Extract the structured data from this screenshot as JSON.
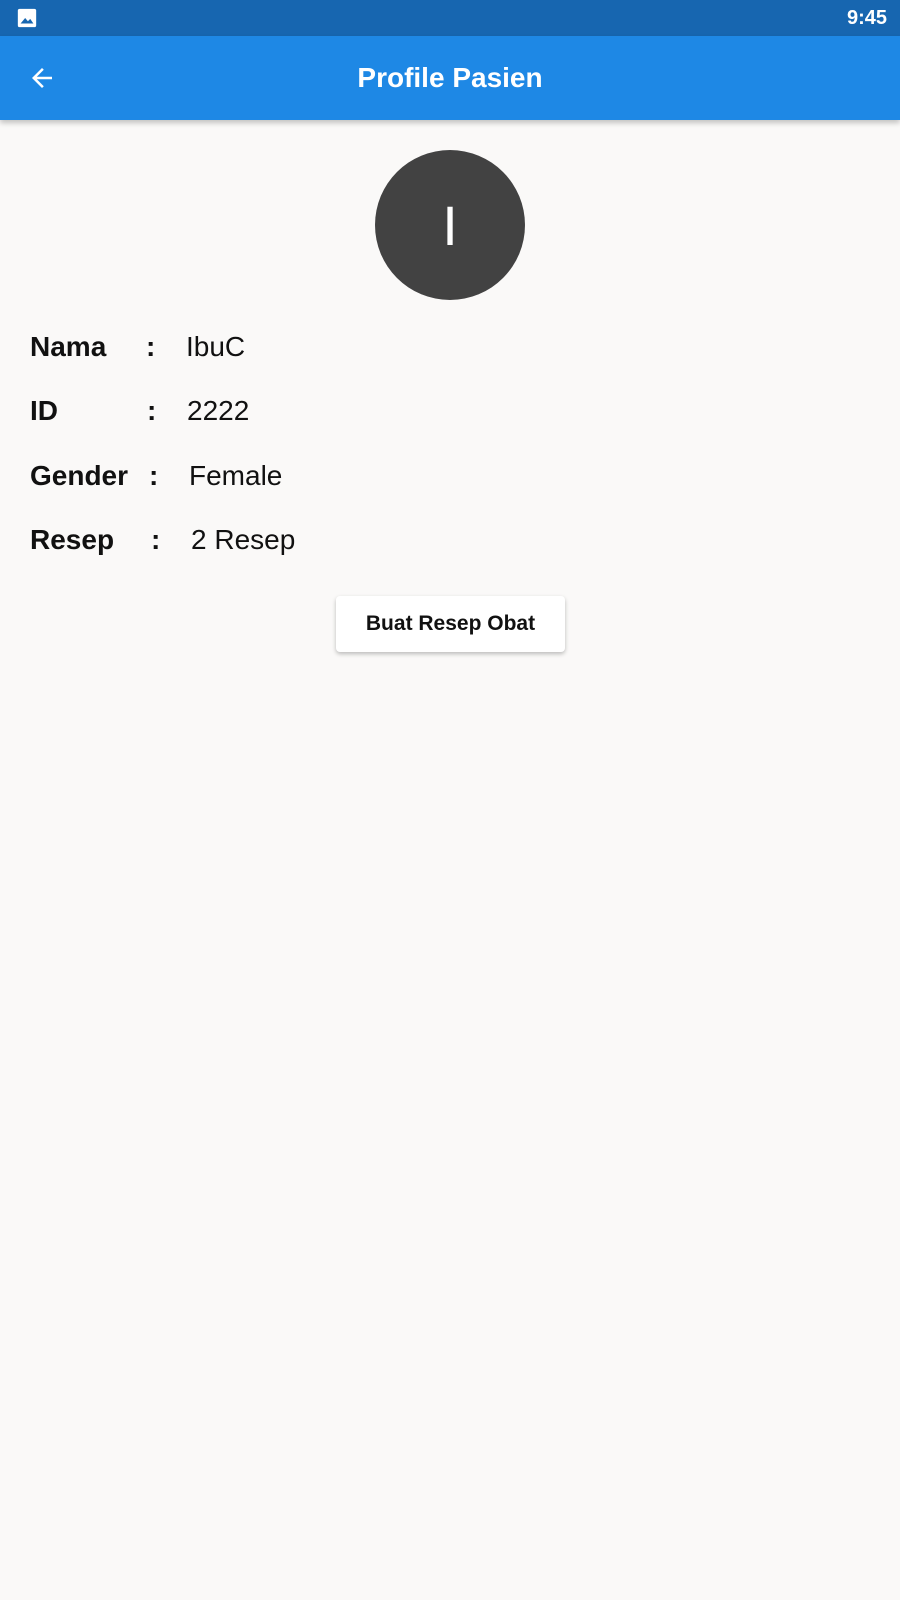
{
  "status_bar": {
    "time": "9:45",
    "notification_icon": "image-icon"
  },
  "app_bar": {
    "back_icon": "arrow-back-icon",
    "title": "Profile Pasien"
  },
  "profile": {
    "avatar_initial": "I",
    "rows": [
      {
        "label": "Nama",
        "separator": ":",
        "value": "IbuC"
      },
      {
        "label": "ID",
        "separator": ":",
        "value": "2222"
      },
      {
        "label": "Gender",
        "separator": ":",
        "value": "Female"
      },
      {
        "label": "Resep",
        "separator": ":",
        "value": "2 Resep"
      }
    ]
  },
  "actions": {
    "create_prescription_label": "Buat Resep Obat"
  },
  "colors": {
    "status_bar": "#1766b0",
    "app_bar": "#1e88e5",
    "avatar": "#424242",
    "background": "#faf9f8"
  }
}
